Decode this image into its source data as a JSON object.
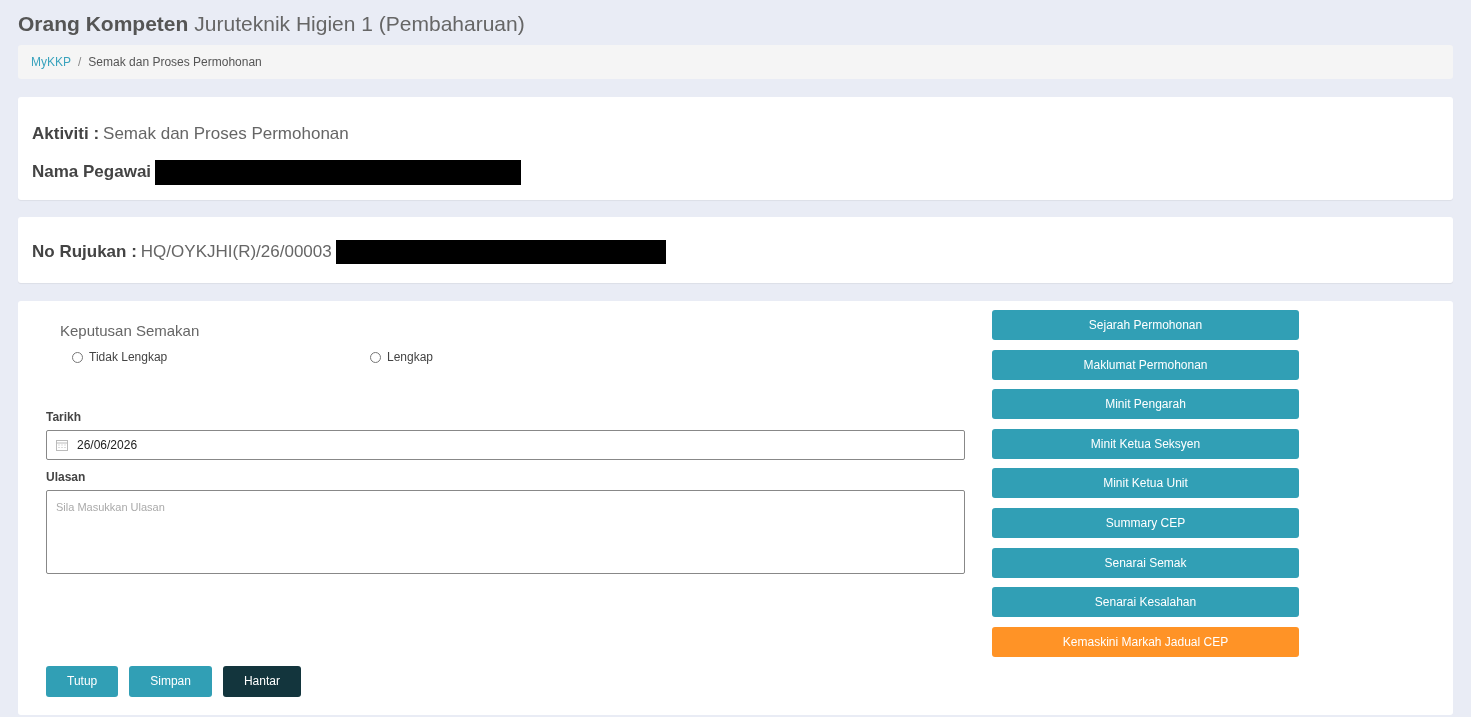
{
  "page": {
    "title": "Orang Kompeten",
    "subtitle": "Juruteknik Higien 1 (Pembaharuan)"
  },
  "breadcrumb": {
    "separator": "/",
    "items": [
      {
        "label": "MyKKP",
        "kind": "link"
      },
      {
        "label": "Semak dan Proses Permohonan",
        "kind": "current"
      }
    ]
  },
  "activity_card": {
    "fields": [
      {
        "label": "Aktiviti :",
        "value": "Semak dan Proses Permohonan"
      },
      {
        "label": "Nama Pegawai",
        "redacted": true
      }
    ]
  },
  "reference_card": {
    "label": "No Rujukan :",
    "value": "HQ/OYKJHI(R)/26/00003",
    "redacted": true
  },
  "form": {
    "decision": {
      "label": "Keputusan Semakan",
      "options": [
        {
          "label": "Tidak Lengkap",
          "selected": false
        },
        {
          "label": "Lengkap",
          "selected": false
        }
      ]
    },
    "date": {
      "label": "Tarikh",
      "value": "26/06/2026"
    },
    "comment": {
      "label": "Ulasan",
      "placeholder": "Sila Masukkan Ulasan"
    },
    "side_buttons": [
      {
        "label": "Sejarah Permohonan",
        "kind": "primary"
      },
      {
        "label": "Maklumat Permohonan",
        "kind": "primary"
      },
      {
        "label": "Minit Pengarah",
        "kind": "primary"
      },
      {
        "label": "Minit Ketua Seksyen",
        "kind": "primary"
      },
      {
        "label": "Minit Ketua Unit",
        "kind": "primary"
      },
      {
        "label": "Summary CEP",
        "kind": "primary"
      },
      {
        "label": "Senarai Semak",
        "kind": "primary"
      },
      {
        "label": "Senarai Kesalahan",
        "kind": "primary"
      },
      {
        "label": "Kemaskini Markah Jadual CEP",
        "kind": "warning"
      }
    ],
    "action_buttons": [
      {
        "label": "Tutup",
        "kind": "primary"
      },
      {
        "label": "Simpan",
        "kind": "primary"
      },
      {
        "label": "Hantar",
        "kind": "dark"
      }
    ]
  }
}
